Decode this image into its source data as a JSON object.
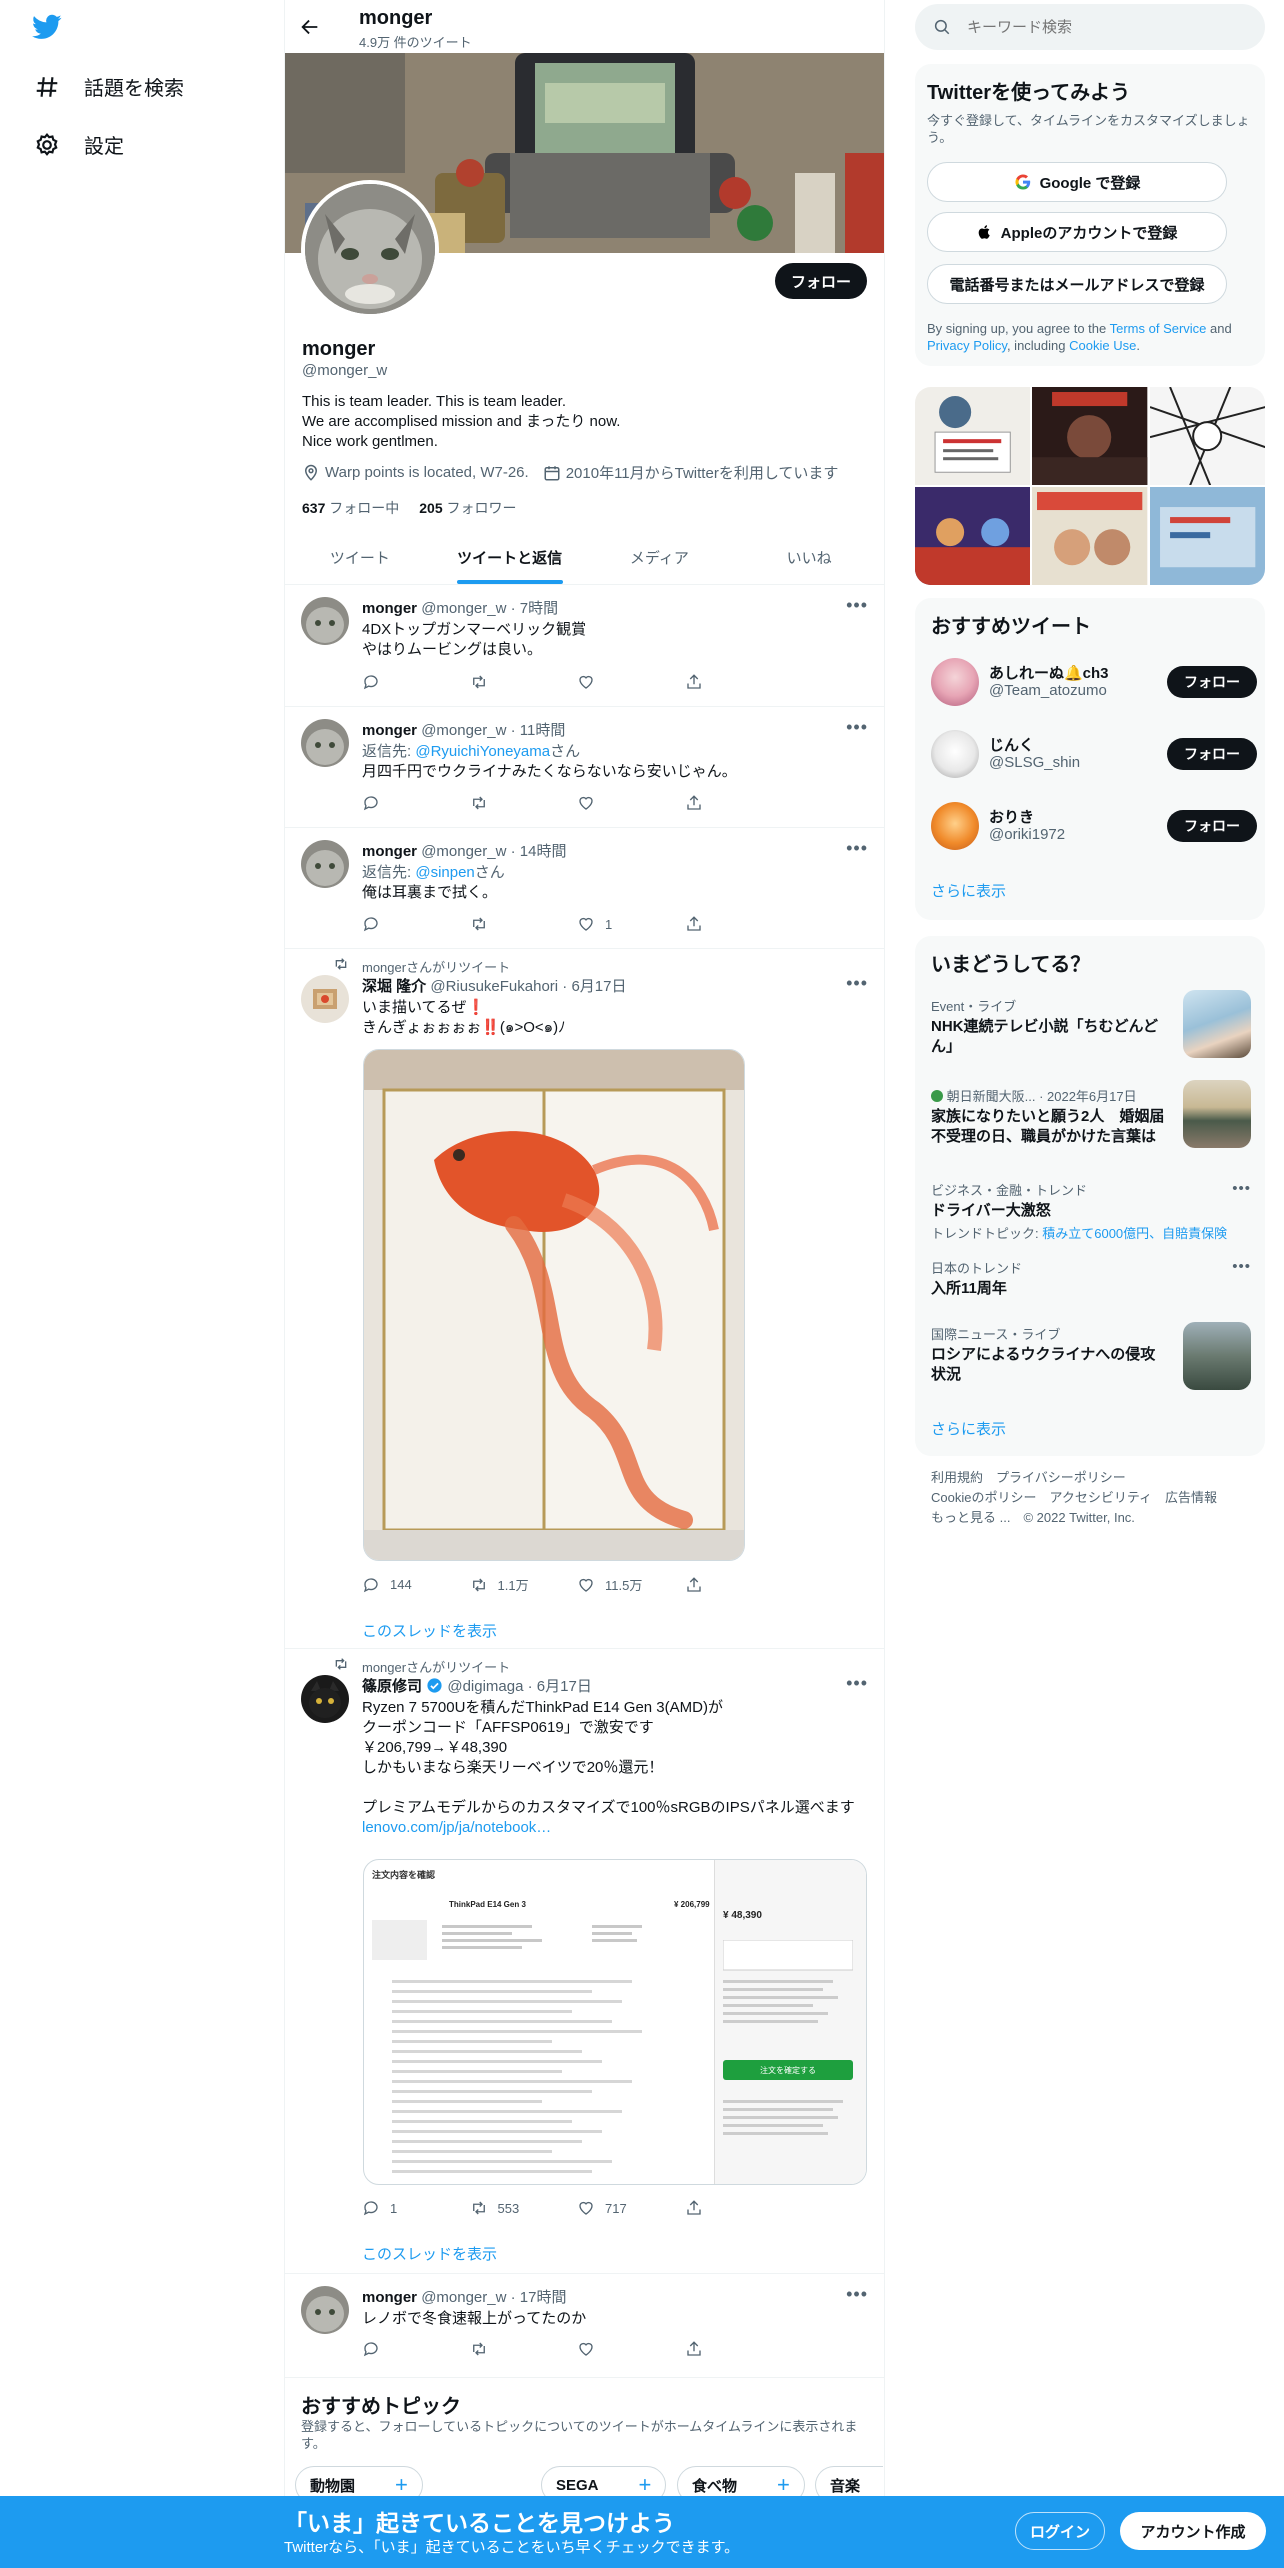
{
  "nav": {
    "explore_label": "話題を検索",
    "settings_label": "設定"
  },
  "header": {
    "title": "monger",
    "tweet_count": "4.9万 件のツイート"
  },
  "profile": {
    "name": "monger",
    "handle": "@monger_w",
    "follow_label": "フォロー",
    "bio_line1": "This is team leader. This is team leader.",
    "bio_line2": "We are accomplised mission and まったり now.",
    "bio_line3": "Nice work gentlmen.",
    "location": "Warp points is located, W7-26.",
    "joined": "2010年11月からTwitterを利用しています",
    "following_count": "637",
    "following_label": "フォロー中",
    "followers_count": "205",
    "followers_label": "フォロワー"
  },
  "tabs": [
    "ツイート",
    "ツイートと返信",
    "メディア",
    "いいね"
  ],
  "tweets": [
    {
      "name": "monger",
      "meta": "@monger_w · 7時間",
      "line1": "4DXトップガンマーベリック観賞",
      "line2": "やはりムービングは良い。"
    },
    {
      "name": "monger",
      "meta": "@monger_w · 11時間",
      "reply_prefix": "返信先: ",
      "reply_to": "@RyuichiYoneyama",
      "reply_suffix": "さん",
      "line1": "月四千円でウクライナみたくならないなら安いじゃん。"
    },
    {
      "name": "monger",
      "meta": "@monger_w · 14時間",
      "reply_prefix": "返信先: ",
      "reply_to": "@sinpen",
      "reply_suffix": "さん",
      "line1": "俺は耳裏まで拭く。",
      "likes": "1"
    },
    {
      "retweet_label": "mongerさんがリツイート",
      "name": "深堀 隆介",
      "meta": "@RiusukeFukahori · 6月17日",
      "line1": "いま描いてるぜ❗️",
      "line2": "きんぎょぉぉぉぉ‼️(๑>O<๑)ﾉ",
      "replies": "144",
      "retweets": "1.1万",
      "likes": "11.5万",
      "thread_label": "このスレッドを表示"
    },
    {
      "retweet_label": "mongerさんがリツイート",
      "name": "篠原修司",
      "meta": "@digimaga · 6月17日",
      "line1": "Ryzen 7 5700Uを積んだThinkPad E14 Gen 3(AMD)が",
      "line2": "クーポンコード「AFFSP0619」で激安です",
      "line3": "￥206,799→￥48,390",
      "line4": "しかもいまなら楽天リーベイツで20％還元！",
      "line5": "プレミアムモデルからのカスタマイズで100％sRGBのIPSパネル選べます",
      "link": "lenovo.com/jp/ja/notebook…",
      "replies": "1",
      "retweets": "553",
      "likes": "717",
      "thread_label": "このスレッドを表示",
      "screenshot": {
        "header": "注文内容を確認",
        "product": "ThinkPad E14 Gen 3",
        "price_total": "¥ 48,390",
        "price_before": "¥ 206,799",
        "button": "注文を確定する"
      }
    },
    {
      "name": "monger",
      "meta": "@monger_w · 17時間",
      "line1": "レノボで冬食速報上がってたのか"
    }
  ],
  "topics": {
    "title": "おすすめトピック",
    "desc": "登録すると、フォローしているトピックについてのツイートがホームタイムラインに表示されます。",
    "chips": [
      "動物園",
      "SEGA",
      "食べ物",
      "音楽"
    ]
  },
  "search": {
    "placeholder": "キーワード検索"
  },
  "signup": {
    "title": "Twitterを使ってみよう",
    "subtitle": "今すぐ登録して、タイムラインをカスタマイズしましょう。",
    "google": "Google で登録",
    "apple": "Appleのアカウントで登録",
    "phone": "電話番号またはメールアドレスで登録",
    "terms_pre": "By signing up, you agree to the ",
    "terms_link": "Terms of Service",
    "terms_and": " and ",
    "privacy_link": "Privacy Policy",
    "terms_inc": ", including ",
    "cookie_link": "Cookie Use",
    "terms_end": "."
  },
  "recommended": {
    "title": "おすすめツイート",
    "users": [
      {
        "name": "あしれーぬ🔔ch3",
        "handle": "@Team_atozumo"
      },
      {
        "name": "じんく",
        "handle": "@SLSG_shin"
      },
      {
        "name": "おりき",
        "handle": "@oriki1972"
      }
    ],
    "follow_label": "フォロー",
    "more": "さらに表示"
  },
  "trends": {
    "title": "いまどうしてる？",
    "items": [
      {
        "context": "Event・ライブ",
        "title": "NHK連続テレビ小説「ちむどんどん」"
      },
      {
        "context": "朝日新聞大阪... · 2022年6月17日",
        "title": "家族になりたいと願う2人　婚姻届不受理の日、職員がかけた言葉は"
      },
      {
        "context": "ビジネス・金融・トレンド",
        "title": "ドライバー大激怒",
        "topic_label": "トレンドトピック: ",
        "topic_links": "積み立て6000億円、自賠責保険"
      },
      {
        "context": "日本のトレンド",
        "title": "入所11周年"
      },
      {
        "context": "国際ニュース・ライブ",
        "title": "ロシアによるウクライナへの侵攻状況"
      }
    ],
    "more": "さらに表示"
  },
  "footer": {
    "line1": "利用規約　プライバシーポリシー",
    "line2": "Cookieのポリシー　アクセシビリティ　広告情報",
    "line3": "もっと見る ...　© 2022 Twitter, Inc."
  },
  "bottombar": {
    "title": "「いま」起きていることを見つけよう",
    "subtitle": "Twitterなら、「いま」起きていることをいち早くチェックできます。",
    "login": "ログイン",
    "signup": "アカウント作成"
  },
  "colors": {
    "accent": "#1d9bf0",
    "text": "#0f1419",
    "muted": "#536471"
  }
}
